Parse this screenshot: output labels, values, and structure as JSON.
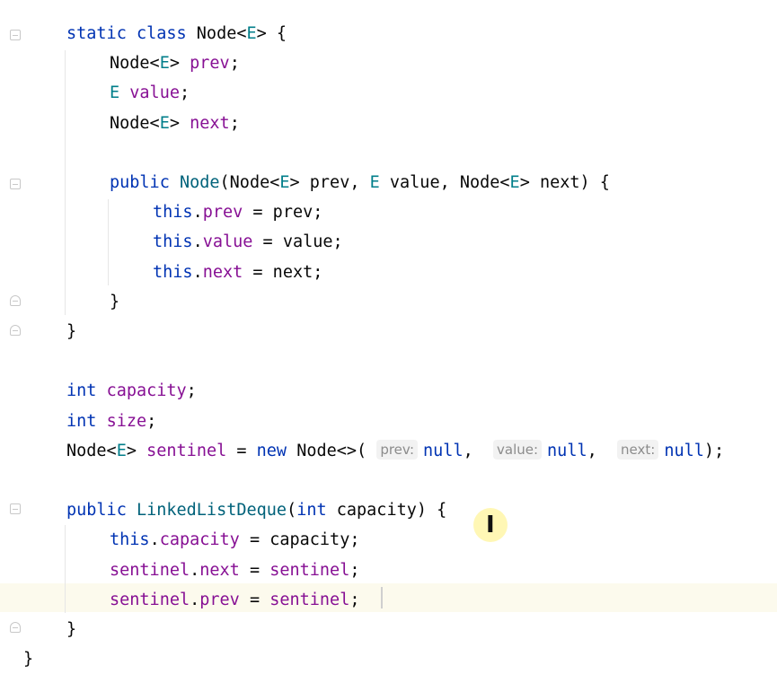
{
  "editor": {
    "lines": [
      [
        {
          "t": "static class ",
          "c": "kw"
        },
        {
          "t": "Node<",
          "c": "plain"
        },
        {
          "t": "E",
          "c": "typ"
        },
        {
          "t": "> {",
          "c": "plain"
        }
      ],
      [
        {
          "t": "Node<",
          "c": "plain"
        },
        {
          "t": "E",
          "c": "typ"
        },
        {
          "t": "> ",
          "c": "plain"
        },
        {
          "t": "prev",
          "c": "fld"
        },
        {
          "t": ";",
          "c": "plain"
        }
      ],
      [
        {
          "t": "E",
          "c": "typ"
        },
        {
          "t": " ",
          "c": "plain"
        },
        {
          "t": "value",
          "c": "fld"
        },
        {
          "t": ";",
          "c": "plain"
        }
      ],
      [
        {
          "t": "Node<",
          "c": "plain"
        },
        {
          "t": "E",
          "c": "typ"
        },
        {
          "t": "> ",
          "c": "plain"
        },
        {
          "t": "next",
          "c": "fld"
        },
        {
          "t": ";",
          "c": "plain"
        }
      ],
      [],
      [
        {
          "t": "public ",
          "c": "kw"
        },
        {
          "t": "Node",
          "c": "fn"
        },
        {
          "t": "(Node<",
          "c": "plain"
        },
        {
          "t": "E",
          "c": "typ"
        },
        {
          "t": "> prev, ",
          "c": "plain"
        },
        {
          "t": "E",
          "c": "typ"
        },
        {
          "t": " value, Node<",
          "c": "plain"
        },
        {
          "t": "E",
          "c": "typ"
        },
        {
          "t": "> next) {",
          "c": "plain"
        }
      ],
      [
        {
          "t": "this",
          "c": "kw"
        },
        {
          "t": ".",
          "c": "plain"
        },
        {
          "t": "prev",
          "c": "fld"
        },
        {
          "t": " = prev;",
          "c": "plain"
        }
      ],
      [
        {
          "t": "this",
          "c": "kw"
        },
        {
          "t": ".",
          "c": "plain"
        },
        {
          "t": "value",
          "c": "fld"
        },
        {
          "t": " = value;",
          "c": "plain"
        }
      ],
      [
        {
          "t": "this",
          "c": "kw"
        },
        {
          "t": ".",
          "c": "plain"
        },
        {
          "t": "next",
          "c": "fld"
        },
        {
          "t": " = next;",
          "c": "plain"
        }
      ],
      [
        {
          "t": "}",
          "c": "plain"
        }
      ],
      [
        {
          "t": "}",
          "c": "plain"
        }
      ],
      [],
      [
        {
          "t": "int ",
          "c": "kw"
        },
        {
          "t": "capacity",
          "c": "fld"
        },
        {
          "t": ";",
          "c": "plain"
        }
      ],
      [
        {
          "t": "int ",
          "c": "kw"
        },
        {
          "t": "size",
          "c": "fld"
        },
        {
          "t": ";",
          "c": "plain"
        }
      ],
      [
        {
          "t": "Node<",
          "c": "plain"
        },
        {
          "t": "E",
          "c": "typ"
        },
        {
          "t": "> ",
          "c": "plain"
        },
        {
          "t": "sentinel",
          "c": "fld"
        },
        {
          "t": " = ",
          "c": "plain"
        },
        {
          "t": "new ",
          "c": "kw"
        },
        {
          "t": "Node<>( ",
          "c": "plain"
        },
        {
          "t": "prev:",
          "c": "hint"
        },
        {
          "t": "null",
          "c": "kw"
        },
        {
          "t": ",  ",
          "c": "plain"
        },
        {
          "t": "value:",
          "c": "hint"
        },
        {
          "t": "null",
          "c": "kw"
        },
        {
          "t": ",  ",
          "c": "plain"
        },
        {
          "t": "next:",
          "c": "hint"
        },
        {
          "t": "null",
          "c": "kw"
        },
        {
          "t": ");",
          "c": "plain"
        }
      ],
      [],
      [
        {
          "t": "public ",
          "c": "kw"
        },
        {
          "t": "LinkedListDeque",
          "c": "fn"
        },
        {
          "t": "(",
          "c": "plain"
        },
        {
          "t": "int ",
          "c": "kw"
        },
        {
          "t": "capacity) {",
          "c": "plain"
        }
      ],
      [
        {
          "t": "this",
          "c": "kw"
        },
        {
          "t": ".",
          "c": "plain"
        },
        {
          "t": "capacity",
          "c": "fld"
        },
        {
          "t": " = capacity;",
          "c": "plain"
        }
      ],
      [
        {
          "t": "sentinel",
          "c": "fld"
        },
        {
          "t": ".",
          "c": "plain"
        },
        {
          "t": "next",
          "c": "fld"
        },
        {
          "t": " = ",
          "c": "plain"
        },
        {
          "t": "sentinel",
          "c": "fld"
        },
        {
          "t": ";",
          "c": "plain"
        }
      ],
      [
        {
          "t": "sentinel",
          "c": "fld"
        },
        {
          "t": ".",
          "c": "plain"
        },
        {
          "t": "prev",
          "c": "fld"
        },
        {
          "t": " = ",
          "c": "plain"
        },
        {
          "t": "sentinel",
          "c": "fld"
        },
        {
          "t": ";",
          "c": "plain"
        }
      ],
      [
        {
          "t": "}",
          "c": "plain"
        }
      ],
      [
        {
          "t": "}",
          "c": "plain"
        }
      ]
    ]
  },
  "colors": {
    "keyword": "#0033b3",
    "type_param": "#007e8a",
    "field": "#871094",
    "method": "#00627a",
    "text": "#080808",
    "current_line": "#fcfaed"
  }
}
